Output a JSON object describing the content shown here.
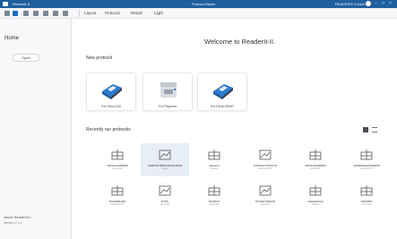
{
  "titlebar": {
    "app_name": "ReaderIt-II",
    "protocol_name": "Protocol Name",
    "user": "READERIT-II User",
    "win_controls": [
      "–",
      "□",
      "×"
    ]
  },
  "toolbar": {
    "menus": [
      "Layout",
      "Protocol",
      "Result",
      "Light"
    ]
  },
  "sidebar": {
    "home_label": "Home",
    "open_label": "Open",
    "about_label": "About ReaderIt-II",
    "version": "Version 2.1.1"
  },
  "main": {
    "welcome": "Welcome to ReaderIt-II.",
    "new_protocol_title": "New protocol",
    "new_protocols": [
      {
        "label": "For Flexit-200",
        "icon": "reader-device-icon"
      },
      {
        "label": "For Payment",
        "icon": "printer-device-icon"
      },
      {
        "label": "For Flexit-200HT",
        "icon": "reader-device-icon"
      }
    ],
    "recent_title": "Recently run protocols",
    "recent": [
      {
        "name": "20231221080829",
        "sub": "Flexit-200",
        "icon": "plate-icon"
      },
      {
        "name": "S32FWSTBKDOSF6G4SFR",
        "sub": "Kinetic",
        "icon": "chart-icon"
      },
      {
        "name": "plaquer2",
        "sub": "Kinetic",
        "icon": "plate-icon"
      },
      {
        "name": "SUPPLECTS56TO1",
        "sub": "Flexit-200 HT",
        "icon": "chart-icon"
      },
      {
        "name": "20231221080829",
        "sub": "Flexit-200",
        "icon": "plate-icon"
      },
      {
        "name": "LSNNRHE33HSDD5N",
        "sub": "Flexit-200 HT",
        "icon": "plate-icon"
      },
      {
        "name": "5GH6S5GDR",
        "sub": "Flexit-200 HT",
        "icon": "plate-icon"
      },
      {
        "name": "DT6S",
        "sub": "Flexit-200",
        "icon": "chart-icon"
      },
      {
        "name": "35225GT",
        "sub": "Flexit-200",
        "icon": "plate-icon"
      },
      {
        "name": "5GTHE7S4W2S",
        "sub": "Flexit-200",
        "icon": "chart-icon"
      },
      {
        "name": "HHHHHHHH",
        "sub": "Flexit-9",
        "icon": "plate-icon"
      },
      {
        "name": "21923554",
        "sub": "Flexit-200",
        "icon": "plate-icon"
      }
    ]
  },
  "colors": {
    "accent": "#1f5f9e",
    "device_blue": "#2a7bd1"
  }
}
